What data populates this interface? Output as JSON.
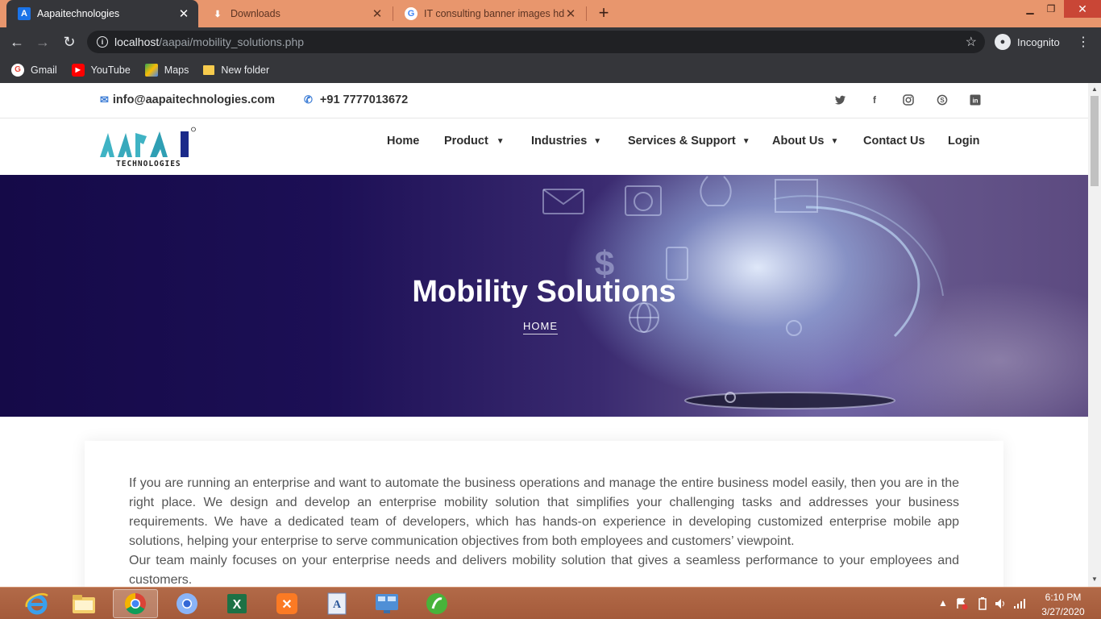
{
  "browser": {
    "tabs": [
      {
        "title": "Aapaitechnologies",
        "icon": "a-favicon",
        "active": true
      },
      {
        "title": "Downloads",
        "icon": "download-icon",
        "active": false
      },
      {
        "title": "IT consulting banner images hd -",
        "icon": "google-icon",
        "active": false
      }
    ],
    "new_tab": "+",
    "url_host": "localhost",
    "url_path": "/aapai/mobility_solutions.php",
    "profile_label": "Incognito",
    "bookmarks": [
      {
        "label": "Gmail",
        "icon": "google-icon"
      },
      {
        "label": "YouTube",
        "icon": "youtube-icon"
      },
      {
        "label": "Maps",
        "icon": "maps-icon"
      },
      {
        "label": "New folder",
        "icon": "folder-icon"
      }
    ]
  },
  "site": {
    "email": "info@aapaitechnologies.com",
    "phone": "+91 7777013672",
    "social": [
      "twitter-icon",
      "facebook-icon",
      "instagram-icon",
      "skype-icon",
      "linkedin-icon"
    ],
    "logo_text": "AAPAI",
    "logo_sub": "TECHNOLOGIES",
    "nav": {
      "home": "Home",
      "product": "Product",
      "industries": "Industries",
      "services": "Services & Support",
      "about": "About Us",
      "contact": "Contact Us",
      "login": "Login"
    },
    "hero_title": "Mobility Solutions",
    "breadcrumb": "HOME",
    "paragraph1": "If you are running an enterprise and want to automate the business operations and manage the entire business model easily, then you are in the right place. We design and develop an enterprise mobility solution that simplifies your challenging tasks and addresses your business requirements. We have a dedicated team of developers, which has hands-on experience in developing customized enterprise mobile app solutions, helping your enterprise to serve communication objectives from both employees and customers’ viewpoint.",
    "paragraph2": "Our team mainly focuses on your enterprise needs and delivers mobility solution that gives a seamless performance to your employees and customers."
  },
  "taskbar": {
    "apps": [
      "internet-explorer-icon",
      "file-explorer-icon",
      "chrome-icon",
      "chrome-canary-icon",
      "excel-icon",
      "xampp-icon",
      "word-icon",
      "control-panel-icon",
      "dreamweaver-icon"
    ],
    "time": "6:10 PM",
    "date": "3/27/2020"
  },
  "colors": {
    "tabbar": "#e8966d",
    "chrome_dark": "#35363a",
    "accent_blue": "#3a7bd5",
    "logo_teal": "#3fb3c4",
    "taskbar": "#a45a3a"
  }
}
